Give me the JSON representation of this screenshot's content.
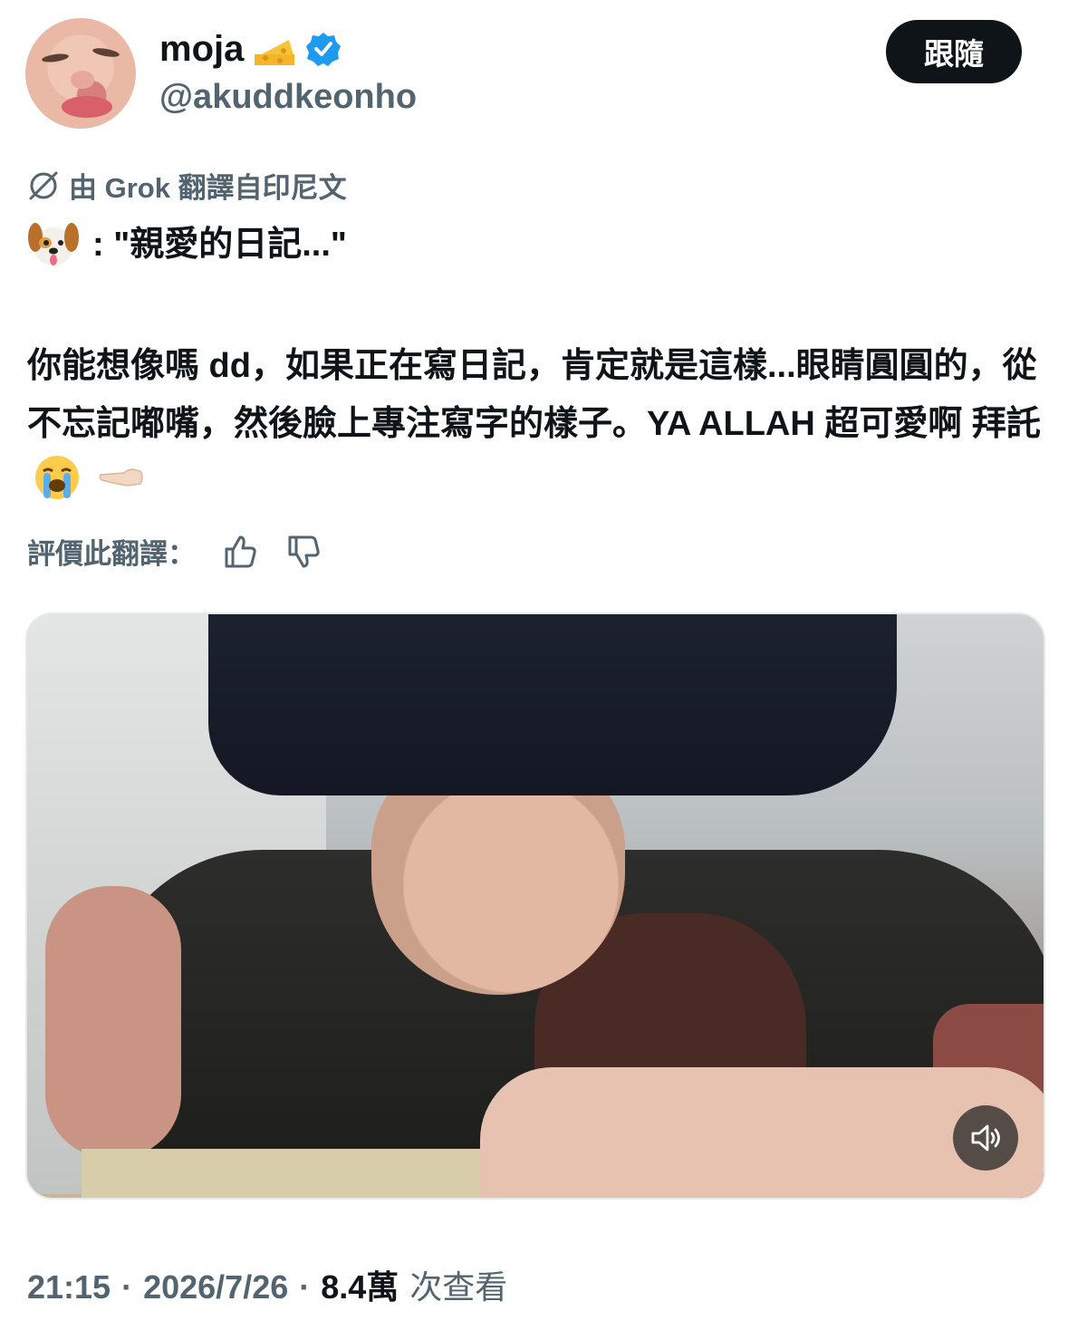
{
  "author": {
    "display_name": "moja",
    "handle": "@akuddkeonho",
    "badge_emoji_icon": "cheese-icon",
    "verified_icon": "verified-badge-icon",
    "verified_color": "#1d9bf0"
  },
  "follow_button": {
    "label": "跟隨",
    "bg_color": "#0f1419"
  },
  "translation": {
    "label": "由 Grok 翻譯自印尼文"
  },
  "tweet": {
    "line1_icon": "dog-face-icon",
    "line1_text": ": \"親愛的日記...\"",
    "body_text": "你能想像嗎 dd，如果正在寫日記，肯定就是這樣...眼睛圓圓的，從不忘記嘟嘴，然後臉上專注寫字的樣子。YA ALLAH 超可愛啊 拜託",
    "trailing_icons": [
      "loudly-crying-face-icon",
      "pointing-left-hand-icon"
    ]
  },
  "rate_translation": {
    "label": "評價此翻譯：",
    "like_icon": "thumbs-up-icon",
    "dislike_icon": "thumbs-down-icon"
  },
  "media": {
    "type": "video",
    "mute_icon": "speaker-icon"
  },
  "meta": {
    "time": "21:15",
    "separator": "·",
    "date": "2026/7/26",
    "views_count": "8.4萬",
    "views_label": "次查看"
  },
  "colors": {
    "text": "#0f1419",
    "secondary": "#536471"
  }
}
